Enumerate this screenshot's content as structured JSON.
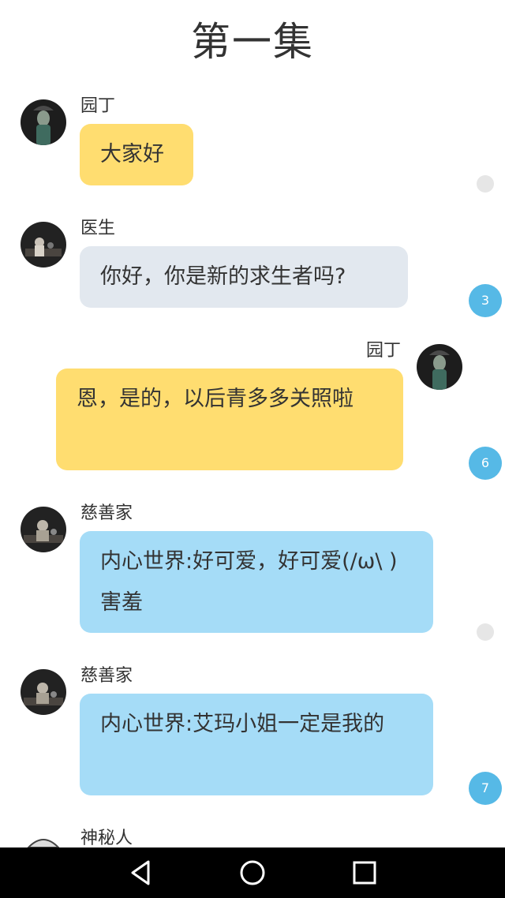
{
  "title": "第一集",
  "messages": [
    {
      "speaker": "园丁",
      "text": "大家好",
      "badge": ""
    },
    {
      "speaker": "医生",
      "text": "你好，你是新的求生者吗?",
      "badge": "3"
    },
    {
      "speaker": "园丁",
      "text": "恩，是的，以后青多多关照啦",
      "badge": "6"
    },
    {
      "speaker": "慈善家",
      "text": "内心世界:好可爱，好可爱(/ω\\ )害羞",
      "badge": ""
    },
    {
      "speaker": "慈善家",
      "text": "内心世界:艾玛小姐一定是我的",
      "badge": "7"
    },
    {
      "speaker": "神秘人",
      "text": "",
      "badge": ""
    }
  ],
  "colors": {
    "bubble_yellow": "#ffdd70",
    "bubble_gray": "#e2e8ef",
    "bubble_blue": "#a5dcf7",
    "badge_blue": "#56b9e6"
  },
  "navigation": {
    "back": "back-icon",
    "home": "home-icon",
    "recents": "recents-icon"
  }
}
